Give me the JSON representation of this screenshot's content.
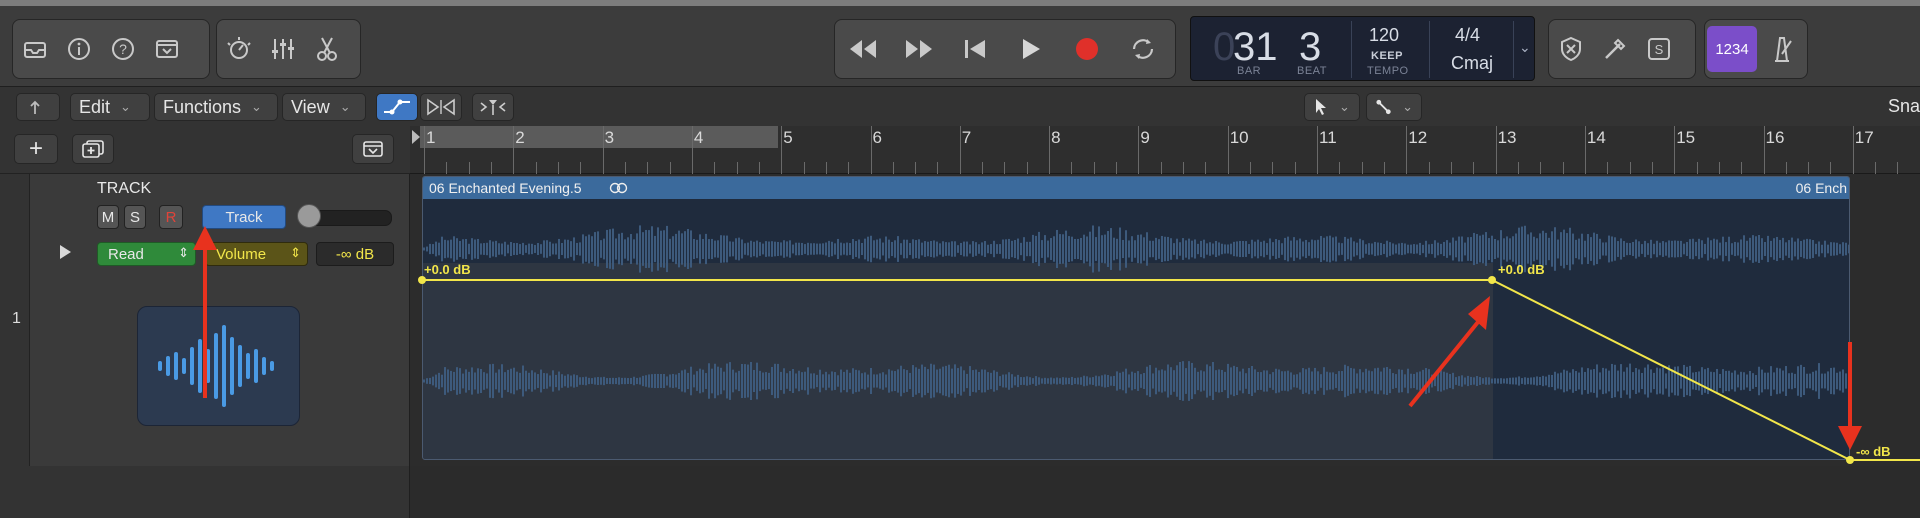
{
  "transport": {
    "bar_dim": "0",
    "bar": "31",
    "beat": "3",
    "bar_label": "BAR",
    "beat_label": "BEAT",
    "tempo": "120",
    "tempo_mode": "KEEP",
    "tempo_label": "TEMPO",
    "time_signature": "4/4",
    "key": "Cmaj",
    "count_in": "1234"
  },
  "menu": {
    "edit": "Edit",
    "functions": "Functions",
    "view": "View",
    "snap": "Sna"
  },
  "ruler": {
    "bars": [
      "1",
      "2",
      "3",
      "4",
      "5",
      "6",
      "7",
      "8",
      "9",
      "10",
      "11",
      "12",
      "13",
      "14",
      "15",
      "16",
      "17"
    ]
  },
  "track": {
    "number": "1",
    "name": "TRACK",
    "mute": "M",
    "solo": "S",
    "record": "R",
    "track_button": "Track",
    "automation_mode": "Read",
    "automation_param": "Volume",
    "automation_value": "-∞ dB"
  },
  "region": {
    "name": "06 Enchanted Evening.5",
    "name_end": "06 Ench",
    "point1": "+0.0 dB",
    "point2": "+0.0 dB",
    "point3": "-∞ dB"
  },
  "colors": {
    "automation": "#f2e64a",
    "region_header": "#3b6a9c",
    "accent_blue": "#3f78c4",
    "read_green": "#2f8a3a",
    "annotation_red": "#e8321e",
    "count_in_purple": "#7b4ec9"
  }
}
